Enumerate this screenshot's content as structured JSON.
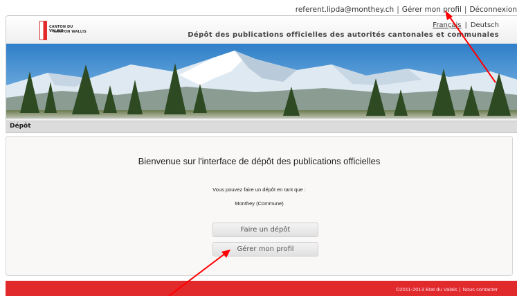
{
  "userbar": {
    "email": "referent.lipda@monthey.ch",
    "sep": "|",
    "profile_link": "Gérer mon profil",
    "logout_link": "Déconnexion"
  },
  "header": {
    "logo_line1": "CANTON DU VALAIS",
    "logo_line2": "KANTON WALLIS",
    "lang_fr": "Français",
    "lang_sep": "|",
    "lang_de": "Deutsch",
    "site_title": "Dépôt des publications officielles des autorités cantonales et communales"
  },
  "breadcrumb": {
    "label": "Dépôt"
  },
  "main": {
    "welcome": "Bienvenue sur l'interface de dépôt des publications officielles",
    "info_line": "Vous pouvez faire un dépôt en tant que :",
    "entity": "Monthey (Commune)",
    "deposit_button": "Faire un dépôt",
    "profile_button": "Gérer mon profil"
  },
  "footer": {
    "copyright": "©2011-2013 Etat du Valais",
    "sep": "|",
    "contact": "Nous contacter"
  },
  "colors": {
    "footer_red": "#e12a2c",
    "arrow_red": "#ff0000"
  }
}
